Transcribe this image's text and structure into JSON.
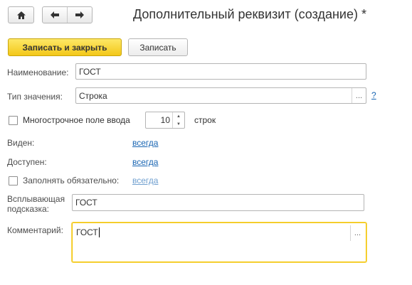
{
  "window": {
    "title": "Дополнительный реквизит (создание) *"
  },
  "nav": {
    "home_icon": "home-icon",
    "back_icon": "arrow-left-icon",
    "forward_icon": "arrow-right-icon"
  },
  "toolbar": {
    "save_close_label": "Записать и закрыть",
    "save_label": "Записать"
  },
  "form": {
    "name": {
      "label": "Наименование:",
      "value": "ГОСТ"
    },
    "value_type": {
      "label": "Тип значения:",
      "value": "Строка",
      "choose": "...",
      "help": "?"
    },
    "multiline": {
      "label": "Многострочное поле ввода",
      "checked": false,
      "lines": "10",
      "lines_suffix": "строк"
    },
    "visible": {
      "label": "Виден:",
      "value": "всегда"
    },
    "available": {
      "label": "Доступен:",
      "value": "всегда"
    },
    "required": {
      "label": "Заполнять обязательно:",
      "checked": false,
      "value": "всегда"
    },
    "tooltip": {
      "label_line1": "Всплывающая",
      "label_line2": "подсказка:",
      "value": "ГОСТ"
    },
    "comment": {
      "label": "Комментарий:",
      "value": "ГОСТ",
      "choose": "..."
    }
  },
  "colors": {
    "primary_button": "#f3c718",
    "link": "#1a66b3",
    "focus_border": "#f2c200"
  }
}
